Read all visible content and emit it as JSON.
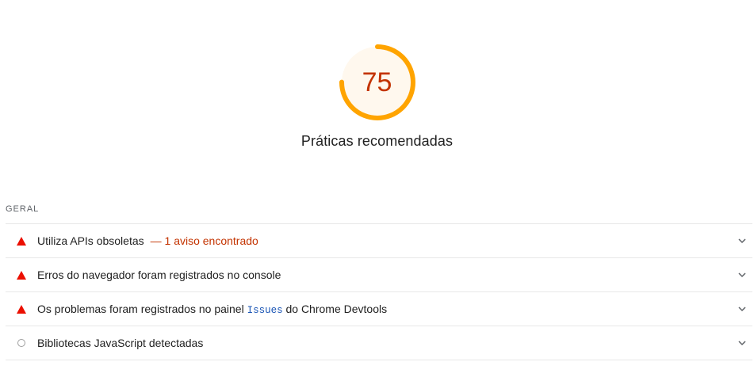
{
  "score": {
    "value": "75",
    "fraction": 0.75,
    "color": "#ffa400",
    "text_color": "#c33300",
    "background": "#fff8ee",
    "title": "Práticas recomendadas"
  },
  "group": {
    "header": "GERAL"
  },
  "audits": [
    {
      "status": "fail",
      "icon": "warning-triangle-icon",
      "title": "Utiliza APIs obsoletas",
      "warning": "— 1 aviso encontrado"
    },
    {
      "status": "fail",
      "icon": "warning-triangle-icon",
      "title": "Erros do navegador foram registrados no console"
    },
    {
      "status": "fail",
      "icon": "warning-triangle-icon",
      "title_before": "Os problemas foram registrados no painel",
      "title_code": "Issues",
      "title_after": "do Chrome Devtools"
    },
    {
      "status": "informative",
      "icon": "informative-circle-icon",
      "title": "Bibliotecas JavaScript detectadas"
    }
  ],
  "colors": {
    "fail": "#eb0f00",
    "neutral": "#9e9e9e",
    "code": "#1a55b5"
  }
}
